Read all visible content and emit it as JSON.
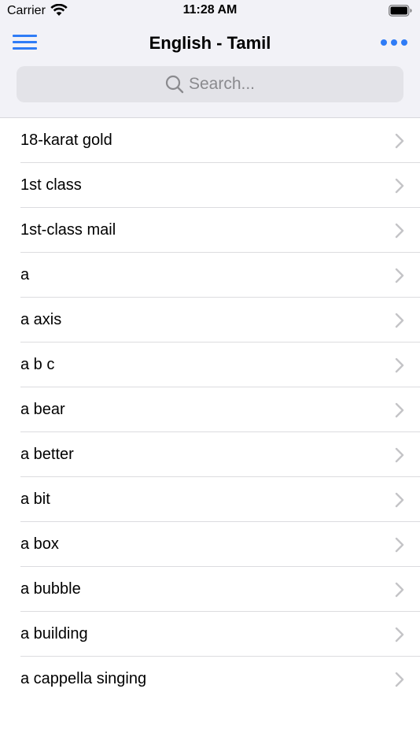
{
  "status_bar": {
    "carrier": "Carrier",
    "time": "11:28 AM",
    "wifi_icon": "wifi-icon",
    "battery_icon": "battery-icon"
  },
  "nav": {
    "title": "English - Tamil",
    "menu_icon": "hamburger-menu-icon",
    "more_icon": "more-dots-icon",
    "accent_color": "#2f7cf6"
  },
  "search": {
    "placeholder": "Search...",
    "icon": "search-icon"
  },
  "list": {
    "items": [
      {
        "label": "18-karat gold"
      },
      {
        "label": "1st class"
      },
      {
        "label": "1st-class mail"
      },
      {
        "label": "a"
      },
      {
        "label": "a axis"
      },
      {
        "label": "a b c"
      },
      {
        "label": "a bear"
      },
      {
        "label": "a better"
      },
      {
        "label": "a bit"
      },
      {
        "label": "a box"
      },
      {
        "label": "a bubble"
      },
      {
        "label": "a building"
      },
      {
        "label": "a cappella singing"
      }
    ],
    "row_icon": "chevron-right-icon"
  }
}
